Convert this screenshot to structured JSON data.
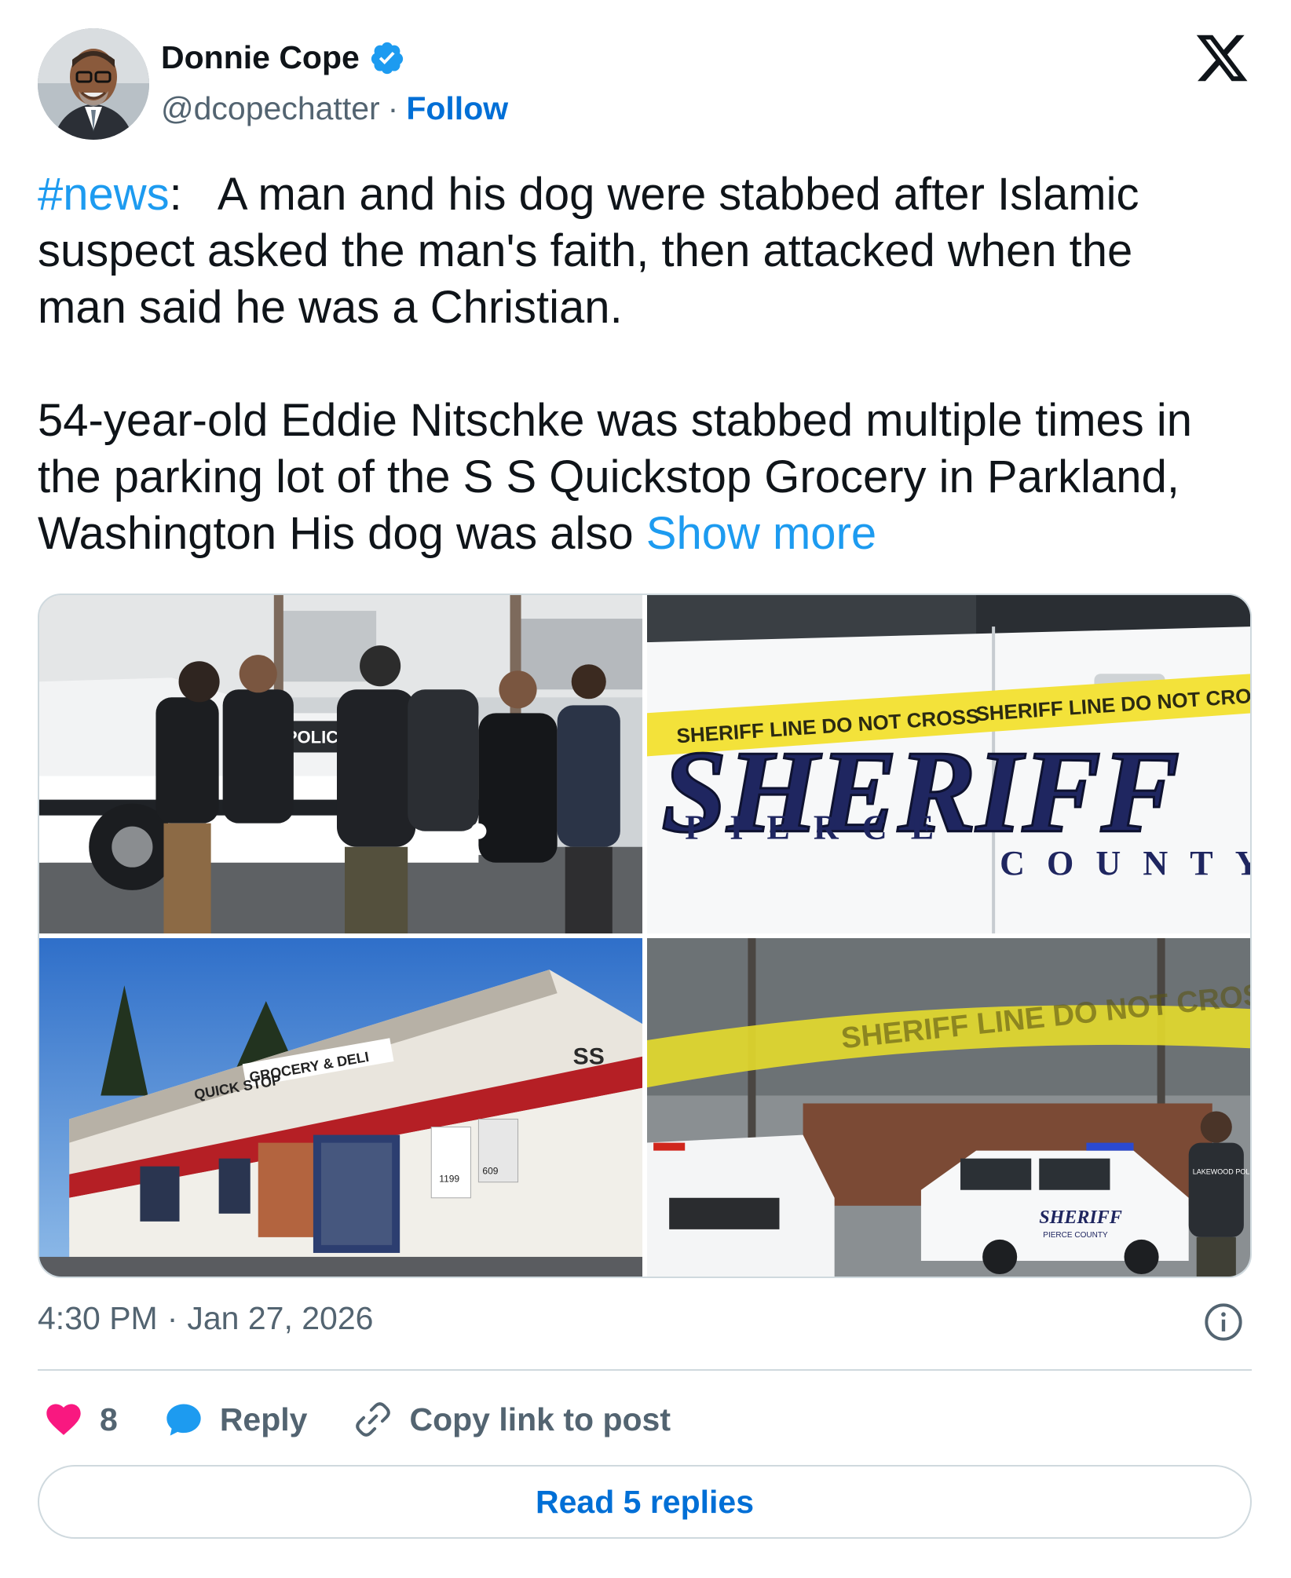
{
  "author": {
    "name": "Donnie Cope",
    "handle": "@dcopechatter",
    "separator": "·",
    "follow_label": "Follow"
  },
  "icons": {
    "verified": "verified-badge-icon",
    "logo": "x-logo-icon",
    "like": "heart-icon",
    "reply": "reply-bubble-icon",
    "copy": "link-icon",
    "info": "info-icon"
  },
  "colors": {
    "accent": "#1d9bf0",
    "link_dark": "#006fd6",
    "like": "#f91880",
    "muted": "#536471"
  },
  "tweet": {
    "hashtag": "#news",
    "text_line1": ":   A man and his dog were stabbed after Islamic\nsuspect asked the man's faith, then attacked when the\nman said he was a Christian.\n\n54-year-old Eddie Nitschke was stabbed multiple times in\nthe parking lot of the S S Quickstop Grocery in Parkland,\nWashington His dog was also ",
    "show_more": "Show more"
  },
  "media": {
    "images": [
      {
        "police_text": "POLICE"
      },
      {
        "tape_text": "SHERIFF LINE DO NOT CROSS",
        "door_big": "SHERIFF",
        "door_pierce": "PIERCE",
        "door_county": "COUNTY"
      },
      {
        "store_sign": "GROCERY & DELI",
        "store_logo": "SS",
        "store_quick": "QUICK STOP",
        "price1": "1199",
        "price2": "609"
      },
      {
        "tape_text": "SHERIFF LINE DO NOT CROSS",
        "car_text": "SHERIFF",
        "car_sub": "PIERCE COUNTY",
        "officer_text": "LAKEWOOD POLICE"
      }
    ]
  },
  "meta": {
    "time": "4:30 PM",
    "sep": "·",
    "date": "Jan 27, 2026"
  },
  "actions": {
    "like_count": "8",
    "reply_label": "Reply",
    "copy_label": "Copy link to post"
  },
  "read_replies_label": "Read 5 replies"
}
